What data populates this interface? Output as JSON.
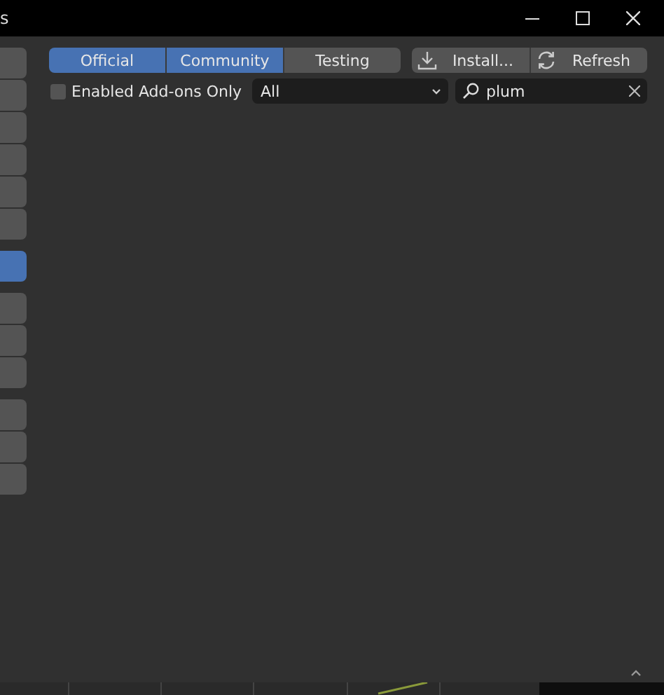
{
  "window": {
    "title": "s"
  },
  "sidebar": {
    "items": [
      {
        "selected": false
      },
      {
        "selected": false
      },
      {
        "selected": false
      },
      {
        "selected": false
      },
      {
        "selected": false
      },
      {
        "selected": false
      },
      {
        "selected": true
      },
      {
        "selected": false
      },
      {
        "selected": false
      },
      {
        "selected": false
      },
      {
        "selected": false
      },
      {
        "selected": false
      },
      {
        "selected": false
      }
    ]
  },
  "sources": [
    {
      "label": "Official",
      "selected": true
    },
    {
      "label": "Community",
      "selected": true
    },
    {
      "label": "Testing",
      "selected": false
    }
  ],
  "actions": [
    {
      "kind": "install",
      "label": "Install..."
    },
    {
      "kind": "refresh",
      "label": "Refresh"
    }
  ],
  "filter": {
    "enabled_only": {
      "label": "Enabled Add-ons Only",
      "checked": false
    },
    "category": "All",
    "search": {
      "value": "plum"
    }
  }
}
